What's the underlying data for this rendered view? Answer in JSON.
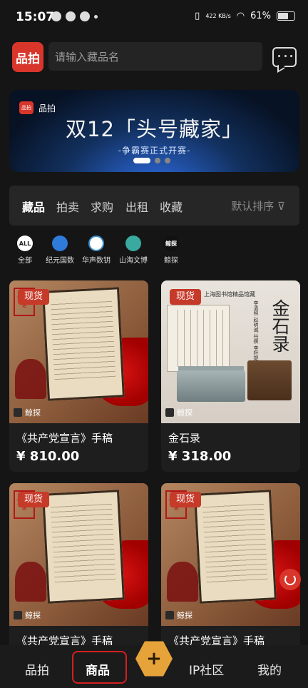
{
  "status_bar": {
    "time": "15:07",
    "net_speed": "422 KB/s",
    "battery": "61%"
  },
  "header": {
    "logo_text": "品拍",
    "search_placeholder": "请输入藏品名"
  },
  "banner": {
    "brand": "品拍",
    "title": "双12「头号藏家」",
    "subtitle": "-争霸赛正式开赛-"
  },
  "tabs": {
    "items": [
      "藏品",
      "拍卖",
      "求购",
      "出租",
      "收藏"
    ],
    "active": "藏品",
    "sort_label": "默认排序"
  },
  "brands": [
    {
      "badge": "ALL",
      "label": "全部",
      "color": "#ffffff"
    },
    {
      "badge": "",
      "label": "纪元国数",
      "color": "#2f7bd9"
    },
    {
      "badge": "",
      "label": "华声数钥",
      "color": "#ffffff"
    },
    {
      "badge": "",
      "label": "山海文博",
      "color": "#3aa9a0"
    },
    {
      "badge": "鲸探",
      "label": "鲸探",
      "color": "#111111"
    }
  ],
  "products": [
    {
      "tag": "现货",
      "shop": "鲸探",
      "name": "《共产党宣言》手稿",
      "price": "¥ 810.00",
      "seal": "千呼百诺"
    },
    {
      "tag": "现货",
      "shop": "鲸探",
      "name": "金石录",
      "price": "¥ 318.00",
      "header": "上海图书馆精品馆藏",
      "big": "金石录",
      "small": "李清照 赵明诚 共撰 李杯提信手编"
    },
    {
      "tag": "现货",
      "shop": "鲸探",
      "name": "《共产党宣言》手稿",
      "price": "",
      "seal": "千呼百诺"
    },
    {
      "tag": "现货",
      "shop": "鲸探",
      "name": "《共产党宣言》手稿",
      "price": "",
      "seal": "千呼百诺"
    }
  ],
  "bottom_nav": {
    "items": [
      "品拍",
      "商品",
      "IP社区",
      "我的"
    ],
    "active": "商品",
    "plus": "+"
  }
}
